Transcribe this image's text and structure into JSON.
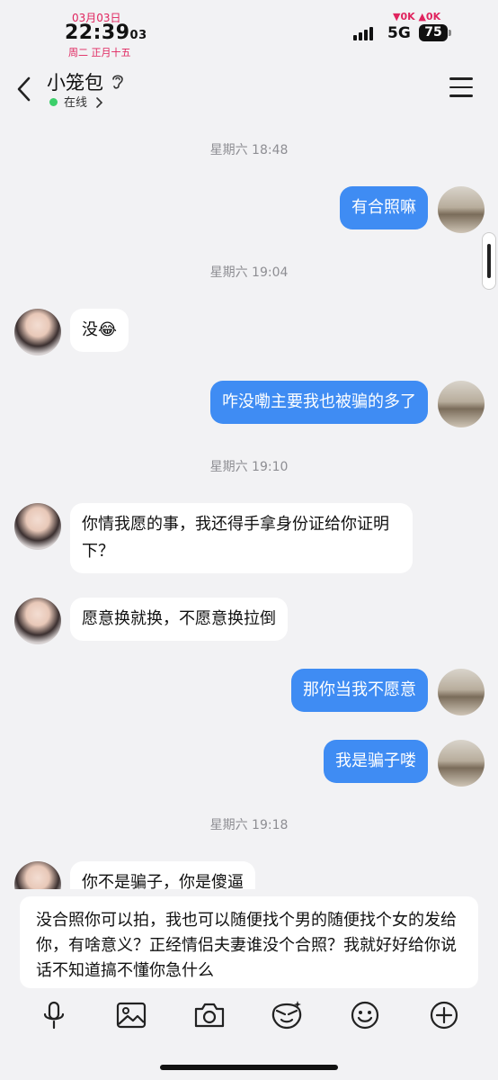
{
  "status_bar": {
    "date": "03月03日",
    "time": "22:39",
    "seconds": "03",
    "lunar": "周二 正月十五",
    "speed": "▼0K ▲0K",
    "network": "5G",
    "battery": "75"
  },
  "header": {
    "contact_name": "小笼包",
    "status": "在线"
  },
  "messages": [
    {
      "type": "time",
      "text": "星期六 18:48"
    },
    {
      "type": "out",
      "text": "有合照嘛"
    },
    {
      "type": "time",
      "text": "星期六 19:04"
    },
    {
      "type": "in",
      "text": "没😂"
    },
    {
      "type": "out",
      "text": "咋没嘞主要我也被骗的多了"
    },
    {
      "type": "time",
      "text": "星期六 19:10"
    },
    {
      "type": "in",
      "text": "你情我愿的事，我还得手拿身份证给你证明下？"
    },
    {
      "type": "in",
      "text": "愿意换就换，不愿意换拉倒"
    },
    {
      "type": "out",
      "text": "那你当我不愿意"
    },
    {
      "type": "out",
      "text": "我是骗子喽"
    },
    {
      "type": "time",
      "text": "星期六 19:18"
    },
    {
      "type": "in",
      "text": "你不是骗子，你是傻逼"
    }
  ],
  "composer": {
    "text": "没合照你可以拍，我也可以随便找个男的随便找个女的发给你，有啥意义？正经情侣夫妻谁没个合照？我就好好给你说话不知道搞不懂你急什么"
  },
  "toolbar": {
    "icons": [
      "microphone-icon",
      "image-icon",
      "camera-icon",
      "sticker-icon",
      "emoji-icon",
      "plus-icon"
    ]
  },
  "colors": {
    "outgoing_bubble": "#3f8cf3",
    "incoming_bubble": "#ffffff",
    "background": "#f2f2f4",
    "online_dot": "#3ccf6a",
    "status_accent": "#e0245e"
  }
}
